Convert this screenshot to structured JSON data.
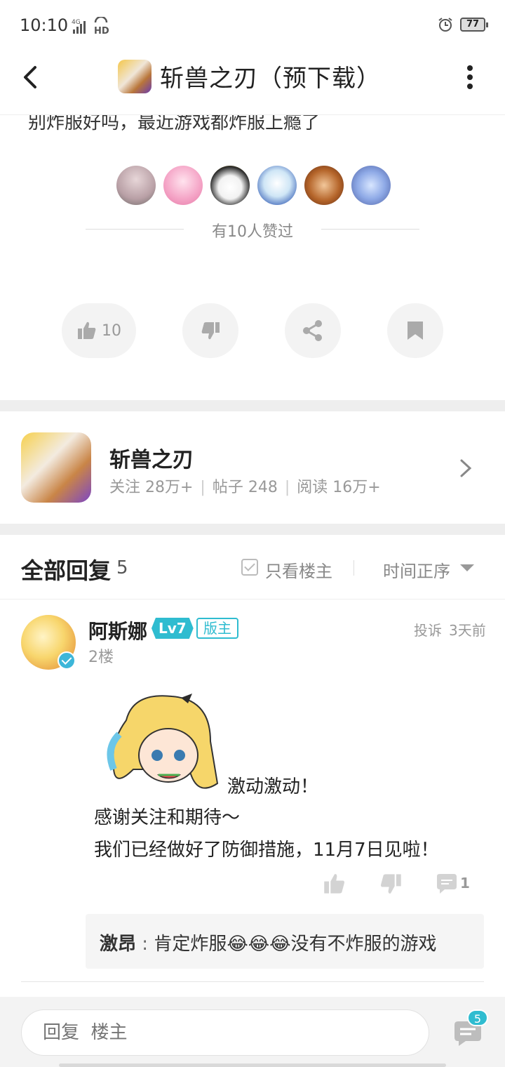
{
  "status_bar": {
    "time": "10:10",
    "network": "4G",
    "hd": "HD",
    "battery": "77"
  },
  "header": {
    "title": "斩兽之刃（预下载）"
  },
  "post": {
    "tail_text": "别炸服好吗，最近游戏都炸服上瘾了",
    "likes_text": "有10人赞过"
  },
  "actions": {
    "like_count": "10"
  },
  "forum": {
    "name": "斩兽之刃",
    "follow": "关注 28万+",
    "posts": "帖子 248",
    "reads": "阅读 16万+"
  },
  "replies": {
    "title": "全部回复",
    "count": "5",
    "only_op": "只看楼主",
    "order": "时间正序"
  },
  "comment": {
    "author": "阿斯娜",
    "level": "Lv7",
    "role": "版主",
    "floor": "2楼",
    "report": "投诉",
    "time": "3天前",
    "line1": "激动激动！",
    "line2": "感谢关注和期待～",
    "line3": "我们已经做好了防御措施，11月7日见啦！",
    "comment_count": "1",
    "sub_reply": {
      "author": "激昂",
      "colon": " : ",
      "text": "肯定炸服😂😂😂没有不炸服的游戏"
    }
  },
  "bottom": {
    "placeholder": "回复  楼主",
    "badge": "5"
  },
  "colors": {
    "accent": "#2fbcd0",
    "divider": "#eeeeee"
  }
}
